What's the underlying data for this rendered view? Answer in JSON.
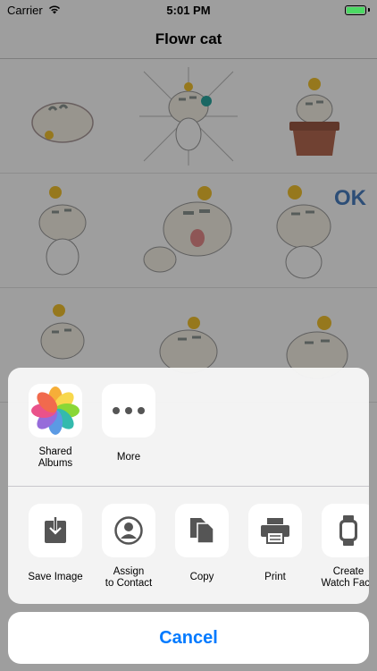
{
  "status_bar": {
    "carrier": "Carrier",
    "time": "5:01 PM",
    "battery_level": 1.0
  },
  "nav": {
    "title": "Flowr cat"
  },
  "colors": {
    "accent": "#007aff",
    "battery": "#4cd964",
    "cat_body": "#f5f0e6",
    "cat_stripe": "#8c9591",
    "flower": "#f2c230"
  },
  "share_sheet": {
    "top_row": [
      {
        "label": "Shared\nAlbums",
        "icon": "photos-icon"
      },
      {
        "label": "More",
        "icon": "more-icon"
      }
    ],
    "actions": [
      {
        "label": "Save Image",
        "icon": "save-image-icon"
      },
      {
        "label": "Assign\nto Contact",
        "icon": "contact-icon"
      },
      {
        "label": "Copy",
        "icon": "copy-icon"
      },
      {
        "label": "Print",
        "icon": "print-icon"
      },
      {
        "label": "Create\nWatch Face",
        "icon": "watch-icon"
      }
    ],
    "cancel": "Cancel"
  }
}
